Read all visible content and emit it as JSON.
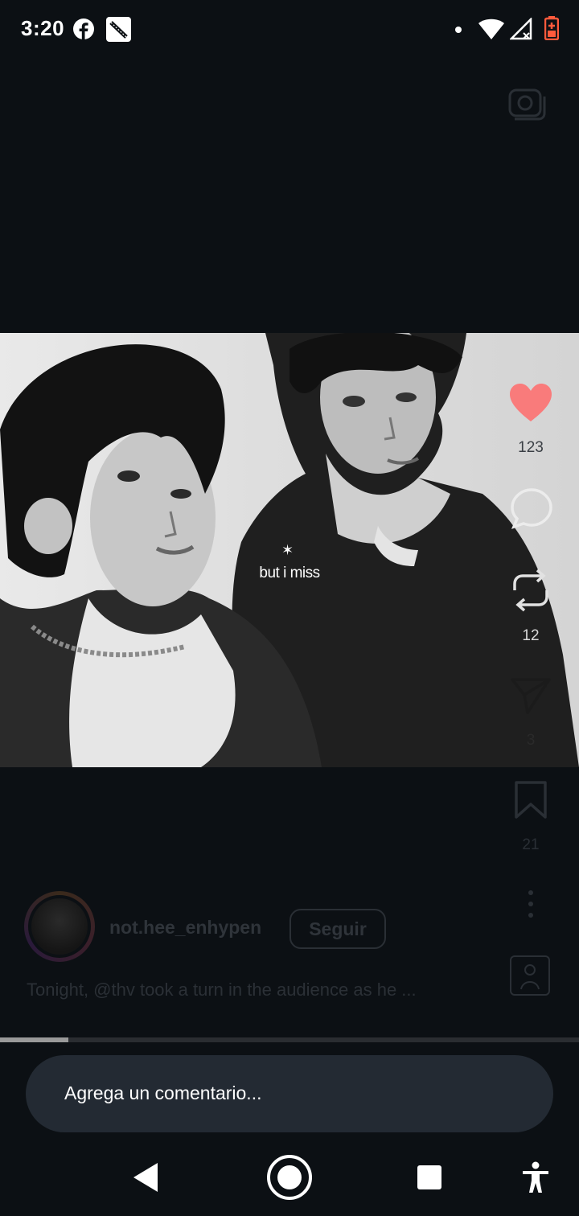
{
  "status_bar": {
    "time": "3:20",
    "icons": [
      "facebook-icon",
      "gallery-icon",
      "notification-dot-icon",
      "wifi-icon",
      "signal-icon",
      "battery-charging-icon"
    ],
    "battery_color": "#ff5a3c"
  },
  "top_actions": {
    "camera_icon": "camera-icon"
  },
  "video": {
    "caption_star": "✶",
    "caption_text": "but i miss",
    "progress": 0.118
  },
  "actions": {
    "like": {
      "icon": "heart-icon",
      "count": "123",
      "color": "#ff6b6b"
    },
    "comment": {
      "icon": "comment-icon",
      "count": ""
    },
    "repost": {
      "icon": "repost-icon",
      "count": "12"
    },
    "share": {
      "icon": "share-icon",
      "count": "3"
    },
    "save": {
      "icon": "bookmark-icon",
      "count": "21"
    },
    "more": {
      "icon": "more-vertical-icon"
    }
  },
  "post": {
    "username": "not.hee_enhypen",
    "follow_label": "Seguir",
    "caption": "Tonight, @thv took a turn in the audience as he ..."
  },
  "comment_input": {
    "placeholder": "Agrega un comentario..."
  },
  "nav": {
    "back": "back-icon",
    "home": "home-icon",
    "recents": "recents-icon",
    "accessibility": "accessibility-icon"
  }
}
